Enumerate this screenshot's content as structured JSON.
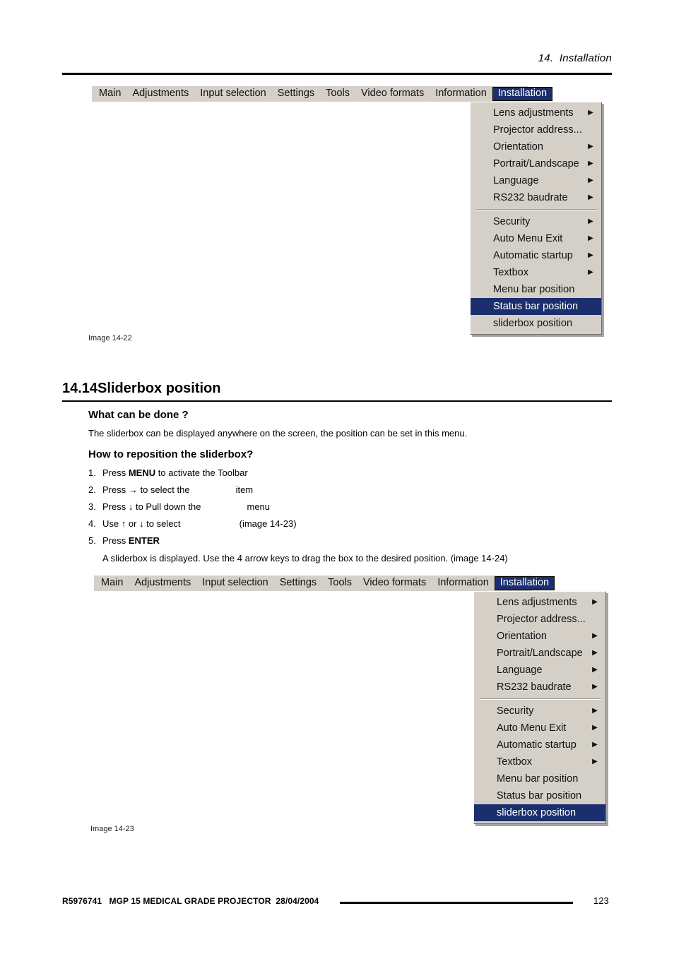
{
  "header": {
    "chapter": "14.  Installation"
  },
  "menu_widget": {
    "menubar_items": [
      "Main",
      "Adjustments",
      "Input selection",
      "Settings",
      "Tools",
      "Video formats",
      "Information",
      "Installation"
    ],
    "active_menubar_item": "Installation",
    "dropdown_group_1": [
      {
        "label": "Lens adjustments",
        "submenu": true
      },
      {
        "label": "Projector address...",
        "submenu": false
      },
      {
        "label": "Orientation",
        "submenu": true
      },
      {
        "label": "Portrait/Landscape",
        "submenu": true
      },
      {
        "label": "Language",
        "submenu": true
      },
      {
        "label": "RS232 baudrate",
        "submenu": true
      }
    ],
    "dropdown_group_2": [
      {
        "label": "Security",
        "submenu": true
      },
      {
        "label": "Auto Menu Exit",
        "submenu": true
      },
      {
        "label": "Automatic startup",
        "submenu": true
      },
      {
        "label": "Textbox",
        "submenu": true
      },
      {
        "label": "Menu bar position",
        "submenu": false
      },
      {
        "label": "Status bar position",
        "submenu": false
      },
      {
        "label": "sliderbox position",
        "submenu": false
      }
    ],
    "submenu_arrow_glyph": "▶",
    "highlight_color": "#1b2f6e",
    "face_color": "#d4d0c8"
  },
  "figure_1": {
    "caption": "Image 14-22",
    "selected_item": "Status bar position"
  },
  "figure_2": {
    "caption": "Image 14-23",
    "selected_item": "sliderbox position"
  },
  "section": {
    "number": "14.14",
    "title": "Sliderbox position",
    "heading_full": "14.14Sliderbox position"
  },
  "what_can_be_done": {
    "heading": "What can be done ?",
    "body": "The sliderbox can be displayed anywhere on the screen, the position can be set in this menu."
  },
  "how_to": {
    "heading": "How to reposition the sliderbox?",
    "steps": [
      {
        "num": "1.",
        "pre": "Press ",
        "bold": "MENU",
        "post": " to activate the Toolbar",
        "gap": "",
        "tail": ""
      },
      {
        "num": "2.",
        "pre": "Press → to select the",
        "bold": "",
        "post": "",
        "gap": "                  ",
        "tail": "item"
      },
      {
        "num": "3.",
        "pre": "Press ↓ to Pull down the",
        "bold": "",
        "post": "",
        "gap": "                  ",
        "tail": "menu"
      },
      {
        "num": "4.",
        "pre": "Use ↑ or ↓ to select",
        "bold": "",
        "post": "",
        "gap": "                       ",
        "tail": "(image 14-23)"
      },
      {
        "num": "5.",
        "pre": "Press ",
        "bold": "ENTER",
        "post": "",
        "gap": "",
        "tail": ""
      }
    ],
    "result_note": "A sliderbox is displayed.  Use the 4 arrow keys to drag the box to the desired position.  (image 14-24)"
  },
  "footer": {
    "document_id": "R5976741",
    "product": "MGP 15 MEDICAL GRADE PROJECTOR",
    "date": "28/04/2004",
    "line": "R5976741   MGP 15 MEDICAL GRADE PROJECTOR  28/04/2004",
    "page_number": "123"
  }
}
